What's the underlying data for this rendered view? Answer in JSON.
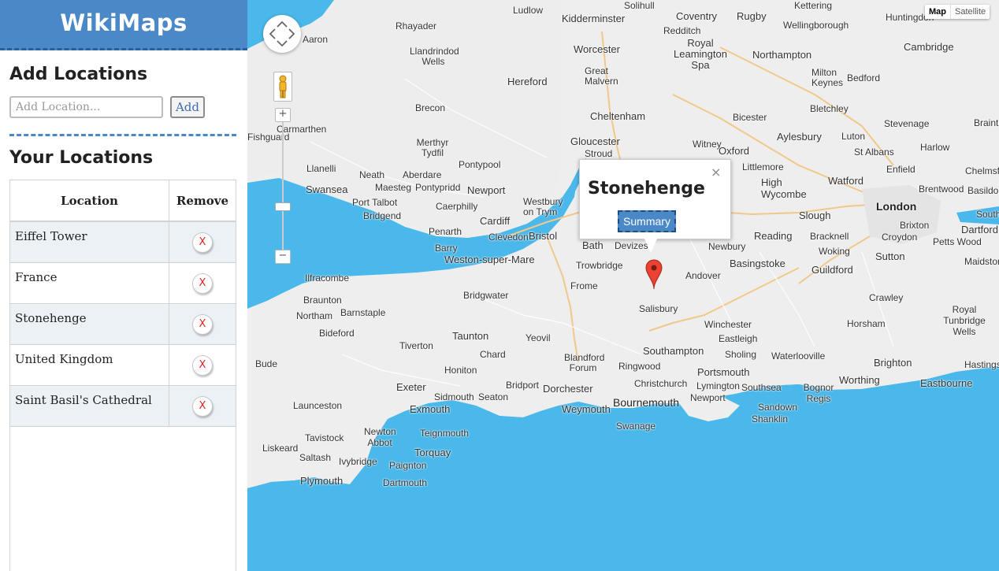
{
  "sidebar": {
    "brand": "WikiMaps",
    "add_heading": "Add Locations",
    "input_placeholder": "Add Location...",
    "add_button": "Add",
    "locations_heading": "Your Locations",
    "table_headers": [
      "Location",
      "Remove"
    ],
    "remove_label": "X",
    "locations": [
      "Eiffel Tower",
      "France",
      "Stonehenge",
      "United Kingdom",
      "Saint Basil's Cathedral"
    ]
  },
  "map": {
    "type_map": "Map",
    "type_satellite": "Satellite",
    "zoom_in": "+",
    "zoom_out": "−",
    "popup_title": "Stonehenge",
    "popup_close": "×",
    "summary_button": "Summary",
    "places": [
      "Solihull",
      "Coventry",
      "Rugby",
      "Kettering",
      "Huntingdon",
      "Ludlow",
      "Kidderminster",
      "Redditch",
      "Wellingborough",
      "Rhayader",
      "Worcester",
      "Royal Leamington Spa",
      "Northampton",
      "Cambridge",
      "Llandrindod Wells",
      "Great Malvern",
      "Hereford",
      "Milton Keynes",
      "Bedford",
      "Brecon",
      "Cheltenham",
      "Bletchley",
      "Carmarthen",
      "Merthyr Tydfil",
      "Gloucester",
      "Stroud",
      "Bicester",
      "Aylesbury",
      "Luton",
      "Stevenage",
      "Pontypool",
      "Witney",
      "Oxford",
      "Harlow",
      "St Albans",
      "Llanelli",
      "Neath",
      "Aberdare",
      "Littlemore",
      "Enfield",
      "Swansea",
      "Maesteg",
      "Pontypridd",
      "Newport",
      "High Wycombe",
      "Watford",
      "Brentwood",
      "Port Talbot",
      "Caerphilly",
      "Westbury on Trym",
      "London",
      "Bridgend",
      "Cardiff",
      "Slough",
      "Penarth",
      "Clevedon",
      "Bristol",
      "Brixton",
      "Dartford",
      "Barry",
      "Bath",
      "Devizes",
      "Reading",
      "Bracknell",
      "Croydon",
      "Weston-super-Mare",
      "Newbury",
      "Woking",
      "Petts Wood",
      "Trowbridge",
      "Basingstoke",
      "Sutton",
      "Guildford",
      "Ilfracombe",
      "Andover",
      "Frome",
      "Bridgwater",
      "Braunton",
      "Barnstaple",
      "Crawley",
      "Salisbury",
      "Royal Tunbridge Wells",
      "Winchester",
      "Horsham",
      "Bideford",
      "Taunton",
      "Yeovil",
      "Eastleigh",
      "Tiverton",
      "Chard",
      "Southampton",
      "Sholing",
      "Waterlooville",
      "Blandford Forum",
      "Brighton",
      "Honiton",
      "Ringwood",
      "Portsmouth",
      "Hastings",
      "Exeter",
      "Bridport",
      "Dorchester",
      "Christchurch",
      "Lymington",
      "Southsea",
      "Worthing",
      "Eastbourne",
      "Sidmouth",
      "Seaton",
      "Bognor Regis",
      "Launceston",
      "Exmouth",
      "Weymouth",
      "Bournemouth",
      "Newport",
      "Sandown",
      "Teignmouth",
      "Swanage",
      "Shanklin",
      "Newton Abbot",
      "Tavistock",
      "Liskeard",
      "Torquay",
      "Saltash",
      "Ivybridge",
      "Paignton",
      "Dartmouth",
      "Plymouth",
      "Bude",
      "Northam",
      "Braintree",
      "Chelmsford",
      "Basildon",
      "Southend-on-Sea",
      "Maidstone",
      "Aaron",
      "Fishguard"
    ]
  }
}
